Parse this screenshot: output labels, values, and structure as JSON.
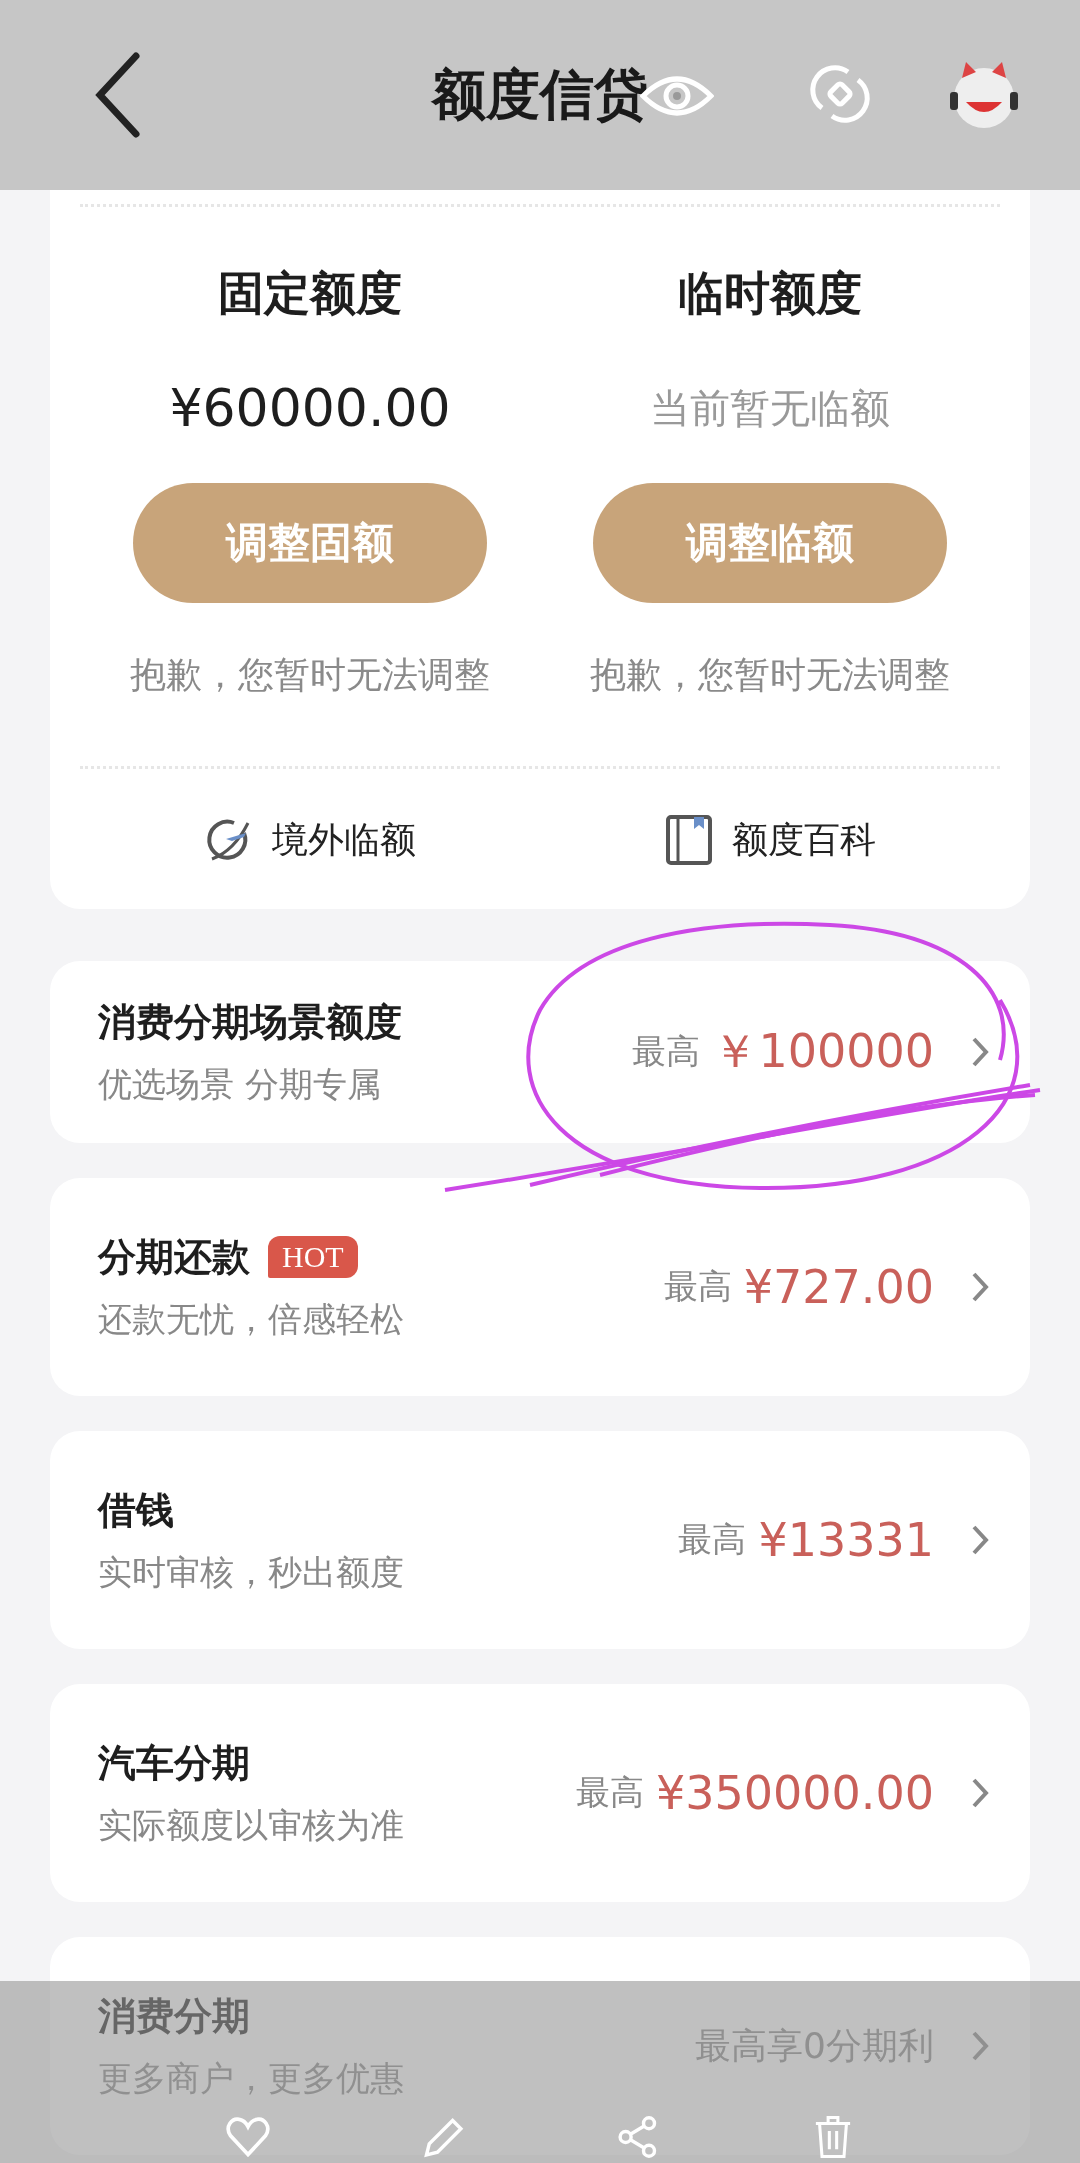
{
  "top_bar": {
    "title": "额度信贷"
  },
  "limits": [
    {
      "kind": "amount",
      "title": "固定额度",
      "amount": "¥60000.00",
      "button": "调整固额",
      "note": "抱歉，您暂时无法调整"
    },
    {
      "kind": "empty",
      "title": "临时额度",
      "amount": "当前暂无临额",
      "button": "调整临额",
      "note": "抱歉，您暂时无法调整"
    }
  ],
  "links": [
    {
      "kind": "travel",
      "label": "境外临额"
    },
    {
      "kind": "book",
      "label": "额度百科"
    }
  ],
  "products": [
    {
      "kind": "amount",
      "title": "消费分期场景额度",
      "subtitle": "优选场景 分期专属",
      "prefix": "最高",
      "amount": "￥100000"
    },
    {
      "kind": "amount",
      "title": "分期还款",
      "badge": "HOT",
      "subtitle": "还款无忧，倍感轻松",
      "prefix": "最高",
      "amount": "¥727.00"
    },
    {
      "kind": "amount",
      "title": "借钱",
      "subtitle": "实时审核，秒出额度",
      "prefix": "最高",
      "amount": "¥13331"
    },
    {
      "kind": "amount",
      "title": "汽车分期",
      "subtitle": "实际额度以审核为准",
      "prefix": "最高",
      "amount": "¥350000.00"
    },
    {
      "kind": "offer",
      "title": "消费分期",
      "subtitle": "更多商户，更多优惠",
      "offer": "最高享0分期利"
    }
  ]
}
